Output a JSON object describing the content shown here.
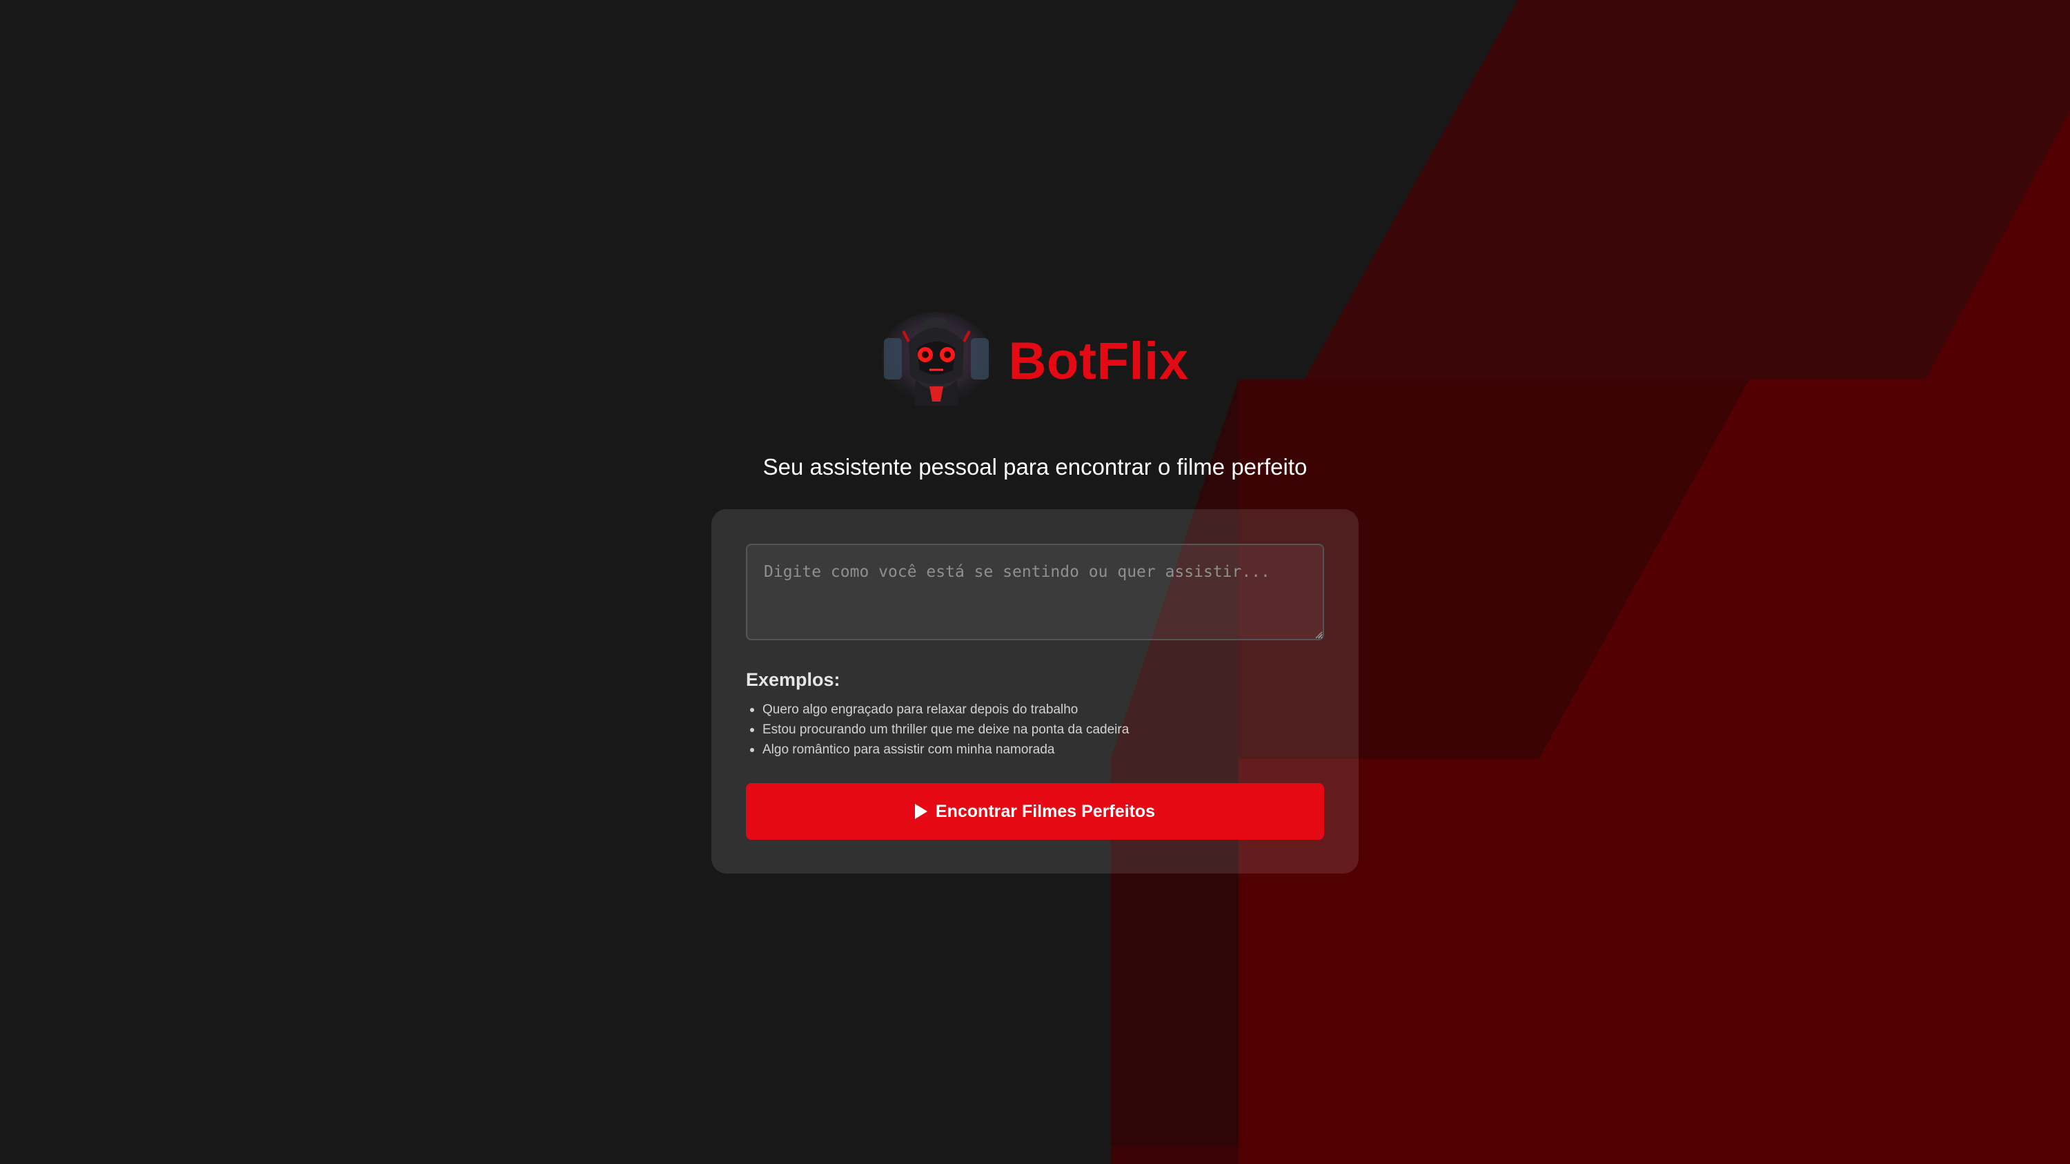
{
  "app": {
    "brand_name": "BotFlix",
    "logo_icon": "robot-avatar-icon",
    "tagline": "Seu assistente pessoal para encontrar o filme perfeito"
  },
  "search": {
    "placeholder": "Digite como você está se sentindo ou quer assistir...",
    "value": ""
  },
  "examples": {
    "title": "Exemplos:",
    "items": [
      "Quero algo engraçado para relaxar depois do trabalho",
      "Estou procurando um thriller que me deixe na ponta da cadeira",
      "Algo romântico para assistir com minha namorada"
    ]
  },
  "cta": {
    "label": "Encontrar Filmes Perfeitos",
    "icon": "play-icon"
  },
  "colors": {
    "background": "#181818",
    "accent": "#e50914",
    "card": "#2e2e2e",
    "dark_red": "#520002"
  }
}
